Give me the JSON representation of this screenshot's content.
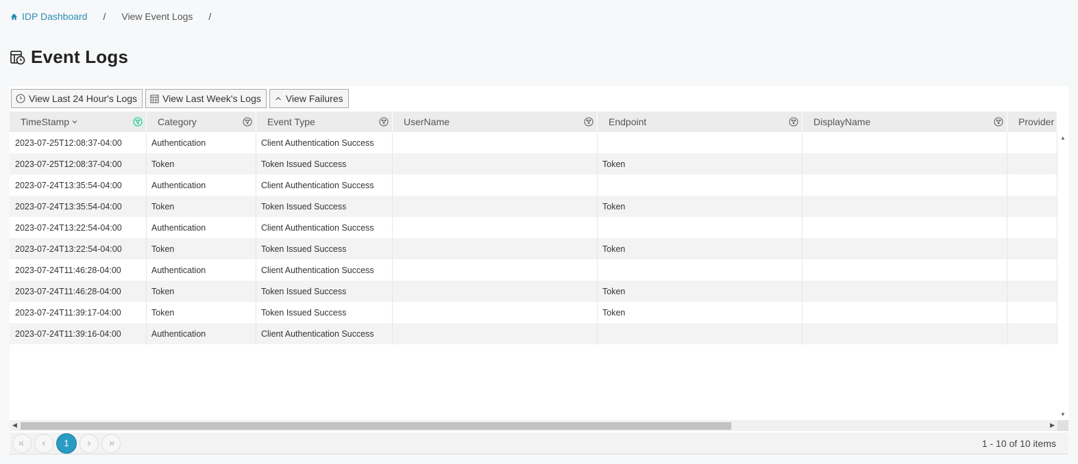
{
  "breadcrumb": {
    "home": "IDP Dashboard",
    "current": "View Event Logs",
    "separator": "/"
  },
  "page": {
    "title": "Event Logs"
  },
  "toolbar": {
    "last24": "View Last 24 Hour's Logs",
    "lastWeek": "View Last Week's Logs",
    "failures": "View Failures"
  },
  "columns": [
    {
      "label": "TimeStamp",
      "sort": "desc",
      "filter_active": true
    },
    {
      "label": "Category",
      "filter_active": false
    },
    {
      "label": "Event Type",
      "filter_active": false
    },
    {
      "label": "UserName",
      "filter_active": false
    },
    {
      "label": "Endpoint",
      "filter_active": false
    },
    {
      "label": "DisplayName",
      "filter_active": false
    },
    {
      "label": "Provider",
      "filter_active": false
    }
  ],
  "rows": [
    [
      "2023-07-25T12:08:37-04:00",
      "Authentication",
      "Client Authentication Success",
      "",
      "",
      "",
      ""
    ],
    [
      "2023-07-25T12:08:37-04:00",
      "Token",
      "Token Issued Success",
      "",
      "Token",
      "",
      ""
    ],
    [
      "2023-07-24T13:35:54-04:00",
      "Authentication",
      "Client Authentication Success",
      "",
      "",
      "",
      ""
    ],
    [
      "2023-07-24T13:35:54-04:00",
      "Token",
      "Token Issued Success",
      "",
      "Token",
      "",
      ""
    ],
    [
      "2023-07-24T13:22:54-04:00",
      "Authentication",
      "Client Authentication Success",
      "",
      "",
      "",
      ""
    ],
    [
      "2023-07-24T13:22:54-04:00",
      "Token",
      "Token Issued Success",
      "",
      "Token",
      "",
      ""
    ],
    [
      "2023-07-24T11:46:28-04:00",
      "Authentication",
      "Client Authentication Success",
      "",
      "",
      "",
      ""
    ],
    [
      "2023-07-24T11:46:28-04:00",
      "Token",
      "Token Issued Success",
      "",
      "Token",
      "",
      ""
    ],
    [
      "2023-07-24T11:39:17-04:00",
      "Token",
      "Token Issued Success",
      "",
      "Token",
      "",
      ""
    ],
    [
      "2023-07-24T11:39:16-04:00",
      "Authentication",
      "Client Authentication Success",
      "",
      "",
      "",
      ""
    ]
  ],
  "pager": {
    "current_page": "1",
    "info": "1 - 10 of 10 items"
  },
  "colors": {
    "accent": "#2a9cc4",
    "link": "#2a8db5"
  }
}
